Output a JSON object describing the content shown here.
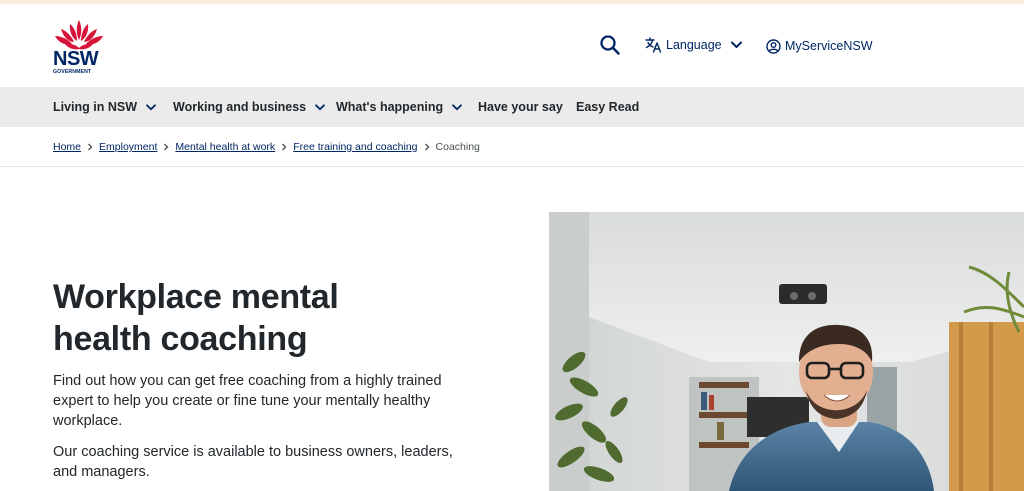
{
  "header": {
    "logo_text": "NSW",
    "logo_subtext": "GOVERNMENT",
    "search_icon": "search-icon",
    "language_label": "Language",
    "myservice_label": "MyServiceNSW"
  },
  "nav": {
    "items": [
      {
        "label": "Living in NSW",
        "has_dropdown": true
      },
      {
        "label": "Working and business",
        "has_dropdown": true
      },
      {
        "label": "What's happening",
        "has_dropdown": true
      },
      {
        "label": "Have your say",
        "has_dropdown": false
      },
      {
        "label": "Easy Read",
        "has_dropdown": false
      }
    ]
  },
  "breadcrumb": {
    "items": [
      {
        "label": "Home"
      },
      {
        "label": "Employment"
      },
      {
        "label": "Mental health at work"
      },
      {
        "label": "Free training and coaching"
      }
    ],
    "current": "Coaching"
  },
  "main": {
    "title_line1": "Workplace mental",
    "title_line2": "health coaching",
    "intro": "Find out how you can get free coaching from a highly trained expert to help you create or fine tune your mentally healthy workplace.",
    "audience": "Our coaching service is available to business owners, leaders, and managers."
  },
  "colors": {
    "brand_navy": "#002664",
    "brand_red": "#d7153a",
    "nav_bg": "#ebebeb",
    "text": "#22272b"
  }
}
